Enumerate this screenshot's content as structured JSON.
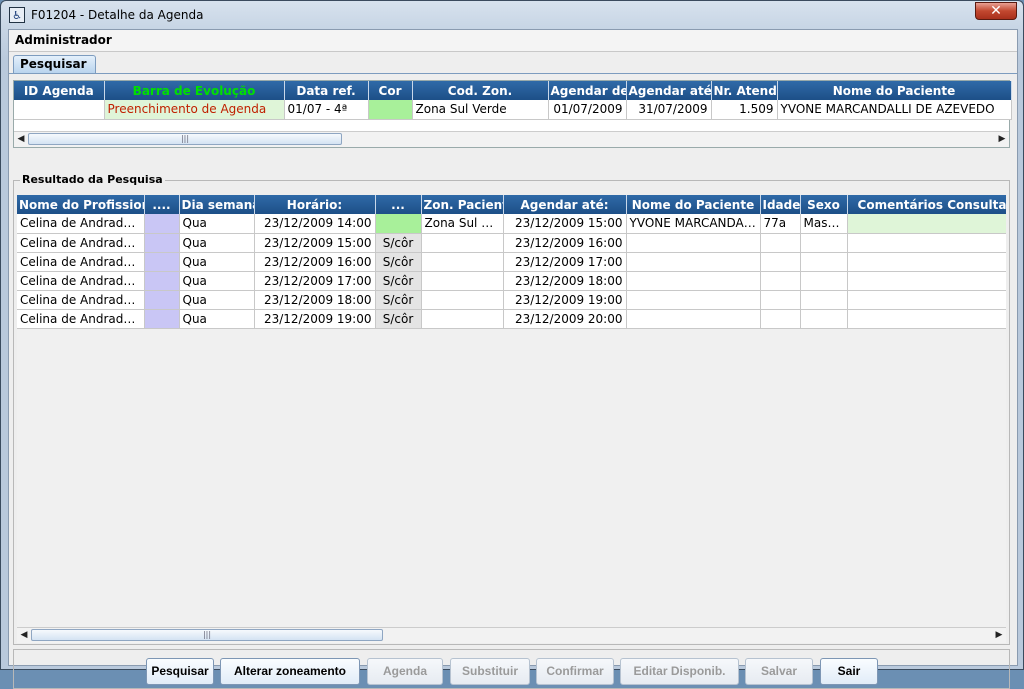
{
  "window": {
    "title": "F01204 - Detalhe da Agenda",
    "close_label": "✕"
  },
  "user_label": "Administrador",
  "tab": {
    "label": "Pesquisar"
  },
  "top_table": {
    "headers": [
      "ID Agenda",
      "Barra de Evolução",
      "Data ref.",
      "Cor",
      "Cod. Zon.",
      "Agendar de:",
      "Agendar até:",
      "Nr. Atendin",
      "Nome do Paciente"
    ],
    "row": [
      "",
      "Preenchimento de Agenda",
      "01/07 - 4ª",
      "",
      "Zona Sul Verde",
      "01/07/2009",
      "31/07/2009",
      "1.509",
      "YVONE MARCANDALLI DE AZEVEDO"
    ]
  },
  "results": {
    "legend": "Resultado da Pesquisa",
    "headers": [
      "Nome do Profissional",
      "....",
      "Dia semana",
      "Horário:",
      "...",
      "Zon. Paciente",
      "Agendar até:",
      "Nome do Paciente",
      "Idade",
      "Sexo",
      "Comentários Consulta"
    ],
    "rows": [
      [
        "Celina de Andrade V...",
        "",
        "Qua",
        "23/12/2009 14:00",
        "",
        "Zona Sul Ve...",
        "23/12/2009 15:00",
        "YVONE MARCANDAL...",
        "77a",
        "Masc...",
        ""
      ],
      [
        "Celina de Andrade V...",
        "",
        "Qua",
        "23/12/2009 15:00",
        "S/côr",
        "",
        "23/12/2009 16:00",
        "",
        "",
        "",
        ""
      ],
      [
        "Celina de Andrade V...",
        "",
        "Qua",
        "23/12/2009 16:00",
        "S/côr",
        "",
        "23/12/2009 17:00",
        "",
        "",
        "",
        ""
      ],
      [
        "Celina de Andrade V...",
        "",
        "Qua",
        "23/12/2009 17:00",
        "S/côr",
        "",
        "23/12/2009 18:00",
        "",
        "",
        "",
        ""
      ],
      [
        "Celina de Andrade V...",
        "",
        "Qua",
        "23/12/2009 18:00",
        "S/côr",
        "",
        "23/12/2009 19:00",
        "",
        "",
        "",
        ""
      ],
      [
        "Celina de Andrade V...",
        "",
        "Qua",
        "23/12/2009 19:00",
        "S/côr",
        "",
        "23/12/2009 20:00",
        "",
        "",
        "",
        ""
      ]
    ]
  },
  "buttons": {
    "pesquisar": "Pesquisar",
    "alterar": "Alterar zoneamento",
    "agenda": "Agenda",
    "substituir": "Substituir",
    "confirmar": "Confirmar",
    "editar": "Editar Disponib.",
    "salvar": "Salvar",
    "sair": "Sair"
  },
  "colors": {
    "header_bg": "#1d4f87",
    "evolution_header_text": "#00e000",
    "evolution_cell_text": "#c02000",
    "evolution_cell_bg": "#dff5d8",
    "green_cell": "#a8f09a",
    "lavender_cell": "#c9c6f5",
    "gray_cell": "#e4e4e4"
  }
}
